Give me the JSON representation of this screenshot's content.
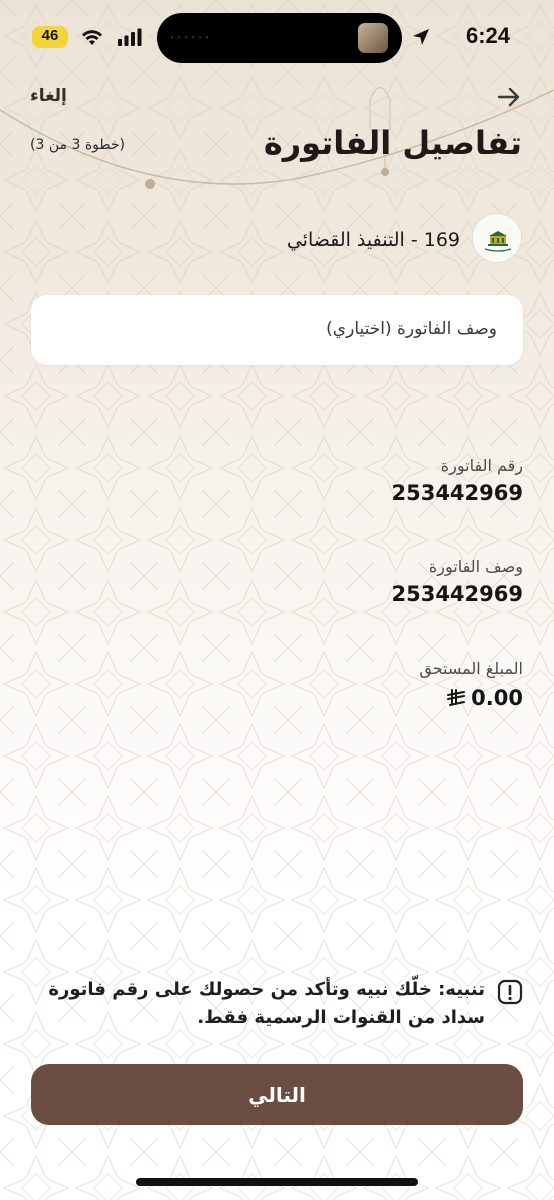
{
  "status_bar": {
    "time": "6:24",
    "battery": "46",
    "island_indicator": "......"
  },
  "header": {
    "cancel_label": "إلغاء",
    "title": "تفاصيل الفاتورة",
    "step": "(خطوة 3 من 3)",
    "back_icon": "arrow-right-icon"
  },
  "biller": {
    "name": "169 - التنفيذ القضائي",
    "logo_icon": "biller-logo-icon"
  },
  "description_input": {
    "placeholder": "وصف الفاتورة (اختياري)"
  },
  "details": [
    {
      "label": "رقم الفاتورة",
      "value": "253442969"
    },
    {
      "label": "وصف الفاتورة",
      "value": "253442969"
    },
    {
      "label": "المبلغ المستحق",
      "value": "0.00",
      "currency_icon": "saudi-riyal-icon"
    }
  ],
  "warning": {
    "text": "تنبيه: خلّك نبيه وتأكد من حصولك على رقم فاتورة سداد من القنوات الرسمية فقط.",
    "icon": "alert-square-icon"
  },
  "next_button": {
    "label": "التالي"
  },
  "colors": {
    "primary": "#6b4d42",
    "background_top": "#ece3d6",
    "text": "#1b1b1b"
  }
}
